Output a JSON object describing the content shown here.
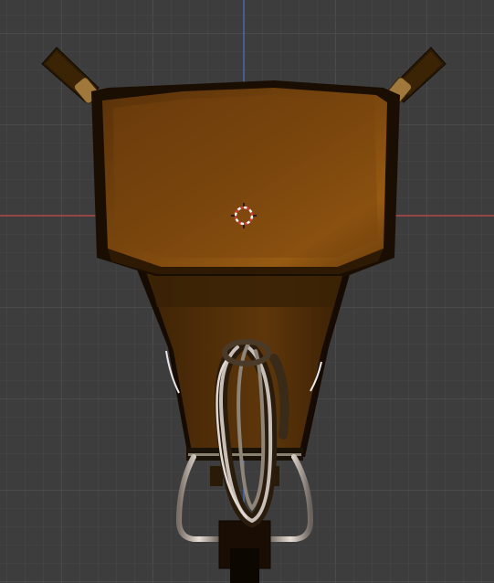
{
  "viewport": {
    "background": "#3d3d3d",
    "grid_minor_color": "#474747",
    "grid_major_color": "#515151",
    "x_axis_color": "#c84a4a",
    "y_axis_color": "#4a74c8"
  },
  "object": {
    "body_color": "#6b3d0c",
    "body_highlight": "#8a5312",
    "body_shadow": "#1e1104",
    "tube_color": "#b8b0a8"
  },
  "cursor": {
    "icon": "3d-cursor-icon",
    "ring_color_a": "#d43a3a",
    "ring_color_b": "#f2f2f2"
  }
}
